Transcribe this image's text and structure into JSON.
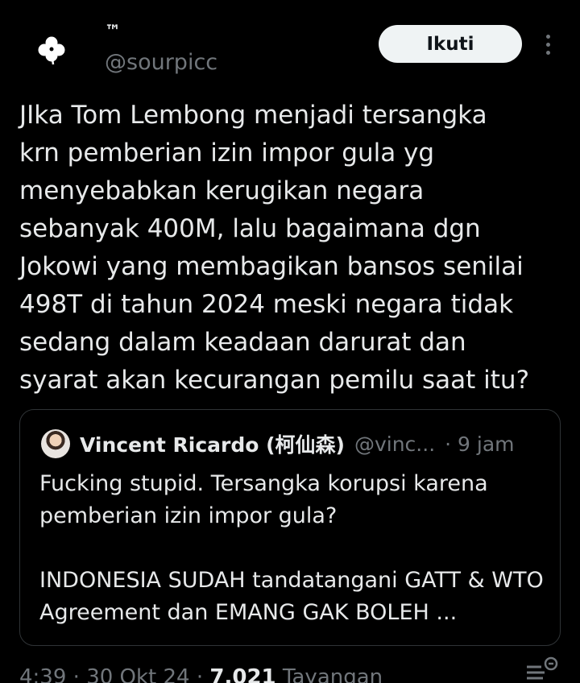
{
  "author": {
    "name": "™",
    "handle": "@sourpicc",
    "avatar_icon": "clover-icon"
  },
  "follow_label": "Ikuti",
  "tweet_text": "JIka Tom Lembong menjadi tersangka\nkrn pemberian izin impor gula yg\nmenyebabkan kerugikan negara\nsebanyak 400M, lalu bagaimana dgn\nJokowi yang membagikan bansos senilai\n498T di tahun 2024 meski negara tidak\nsedang dalam keadaan darurat dan\nsyarat akan kecurangan pemilu saat itu?",
  "quoted_tweet": {
    "name": "Vincent Ricardo (柯仙森)",
    "handle": "@vinc...",
    "time": "· 9 jam",
    "text_paragraph1": "Fucking stupid. Tersangka korupsi karena pemberian izin impor gula?",
    "text_paragraph2": "INDONESIA SUDAH tandatangani GATT & WTO Agreement dan EMANG GAK BOLEH ..."
  },
  "footer": {
    "time": "4:39",
    "date": "30 Okt 24",
    "views_count": "7.021",
    "views_label": "Tayangan"
  },
  "colors": {
    "background": "#000000",
    "text": "#e7e9ea",
    "secondary": "#71767b",
    "border": "#2f3336",
    "button_bg": "#eff3f4"
  }
}
